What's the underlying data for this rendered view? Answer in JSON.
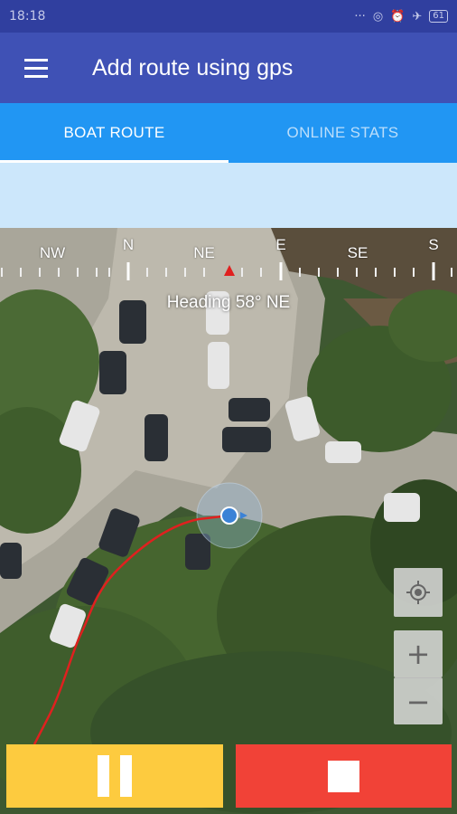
{
  "status_bar": {
    "time": "18:18",
    "icons": [
      "more-dots-icon",
      "hotspot-icon",
      "alarm-icon",
      "airplane-icon",
      "battery-icon"
    ],
    "battery": "61"
  },
  "app_bar": {
    "title": "Add route using gps",
    "menu_icon": "menu-icon"
  },
  "tabs": [
    {
      "label": "BOAT ROUTE",
      "active": true
    },
    {
      "label": "ONLINE STATS",
      "active": false
    }
  ],
  "compass": {
    "labels": [
      "NW",
      "N",
      "NE",
      "E",
      "SE",
      "S"
    ],
    "heading": "Heading 58° NE"
  },
  "map_controls": {
    "locate_icon": "my-location-icon",
    "zoom_in": "+",
    "zoom_out": "−"
  },
  "actions": {
    "pause_icon": "pause-icon",
    "stop_icon": "stop-icon"
  },
  "colors": {
    "primary": "#3f51b5",
    "primary_dark": "#303f9f",
    "tab_blue": "#2196f3",
    "pause": "#fdcb3f",
    "stop": "#f14237",
    "route": "#e0201f"
  }
}
